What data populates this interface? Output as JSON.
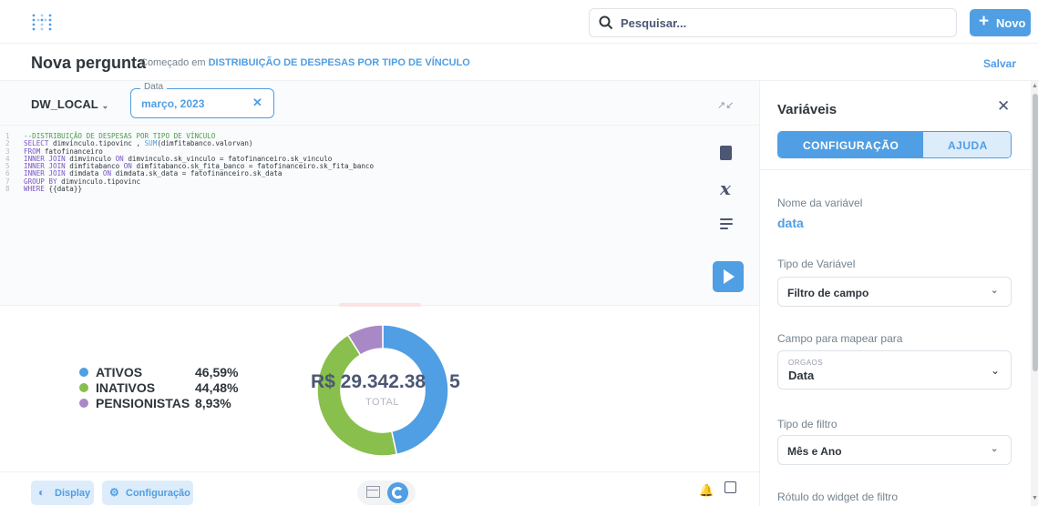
{
  "topbar": {
    "search_placeholder": "Pesquisar...",
    "new_label": "Novo"
  },
  "question": {
    "title": "Nova pergunta",
    "subtitle_prefix": "Começado em",
    "subtitle_link": "DISTRIBUIÇÃO DE DESPESAS POR TIPO DE VÍNCULO",
    "save_label": "Salvar"
  },
  "editor": {
    "database": "DW_LOCAL",
    "date_filter": {
      "label": "Data",
      "value": "março, 2023"
    },
    "code_lines": [
      {
        "n": "1",
        "parts": [
          {
            "c": "cm",
            "t": "--DISTRIBUIÇÃO DE DESPESAS POR TIPO DE VÍNCULO"
          }
        ]
      },
      {
        "n": "2",
        "parts": [
          {
            "c": "kw",
            "t": "SELECT "
          },
          {
            "c": "tx",
            "t": "dimvinculo.tipovinc , "
          },
          {
            "c": "fn",
            "t": "SUM"
          },
          {
            "c": "tx",
            "t": "(dimfitabanco.valorvan)"
          }
        ]
      },
      {
        "n": "3",
        "parts": [
          {
            "c": "kw",
            "t": "FROM "
          },
          {
            "c": "tx",
            "t": "fatofinanceiro"
          }
        ]
      },
      {
        "n": "4",
        "parts": [
          {
            "c": "kw",
            "t": "INNER JOIN "
          },
          {
            "c": "tx",
            "t": "dimvinculo "
          },
          {
            "c": "kw",
            "t": "ON "
          },
          {
            "c": "tx",
            "t": "dimvinculo.sk_vinculo = fatofinanceiro.sk_vinculo"
          }
        ]
      },
      {
        "n": "5",
        "parts": [
          {
            "c": "kw",
            "t": "INNER JOIN "
          },
          {
            "c": "tx",
            "t": "dimfitabanco "
          },
          {
            "c": "kw",
            "t": "ON "
          },
          {
            "c": "tx",
            "t": "dimfitabanco.sk_fita_banco = fatofinanceiro.sk_fita_banco"
          }
        ]
      },
      {
        "n": "6",
        "parts": [
          {
            "c": "kw",
            "t": "INNER JOIN "
          },
          {
            "c": "tx",
            "t": "dimdata "
          },
          {
            "c": "kw",
            "t": "ON "
          },
          {
            "c": "tx",
            "t": "dimdata.sk_data = fatofinanceiro.sk_data"
          }
        ]
      },
      {
        "n": "7",
        "parts": [
          {
            "c": "kw",
            "t": "GROUP BY "
          },
          {
            "c": "tx",
            "t": "dimvinculo.tipovinc"
          }
        ]
      },
      {
        "n": "8",
        "parts": [
          {
            "c": "kw",
            "t": "WHERE "
          },
          {
            "c": "tx",
            "t": "{{data}}"
          }
        ]
      }
    ]
  },
  "visualization": {
    "total_value": "R$ 29.342.38",
    "total_suffix": "5",
    "total_label": "TOTAL"
  },
  "chart_data": {
    "type": "pie",
    "categories": [
      "ATIVOS",
      "INATIVOS",
      "PENSIONISTAS"
    ],
    "values": [
      46.59,
      44.48,
      8.93
    ],
    "labels": [
      "46,59%",
      "44,48%",
      "8,93%"
    ],
    "colors": [
      "#509ee3",
      "#88bf4d",
      "#a989c5"
    ],
    "legend_position": "left"
  },
  "footer": {
    "display_label": "Display",
    "settings_label": "Configuração"
  },
  "panel": {
    "title": "Variáveis",
    "tab_config": "CONFIGURAÇÃO",
    "tab_help": "AJUDA",
    "var_name_label": "Nome da variável",
    "var_name": "data",
    "var_type_label": "Tipo de Variável",
    "var_type": "Filtro de campo",
    "map_field_label": "Campo para mapear para",
    "map_table": "ORGAOS",
    "map_field": "Data",
    "filter_type_label": "Tipo de filtro",
    "filter_type": "Mês e Ano",
    "widget_label_label": "Rótulo do widget de filtro"
  }
}
